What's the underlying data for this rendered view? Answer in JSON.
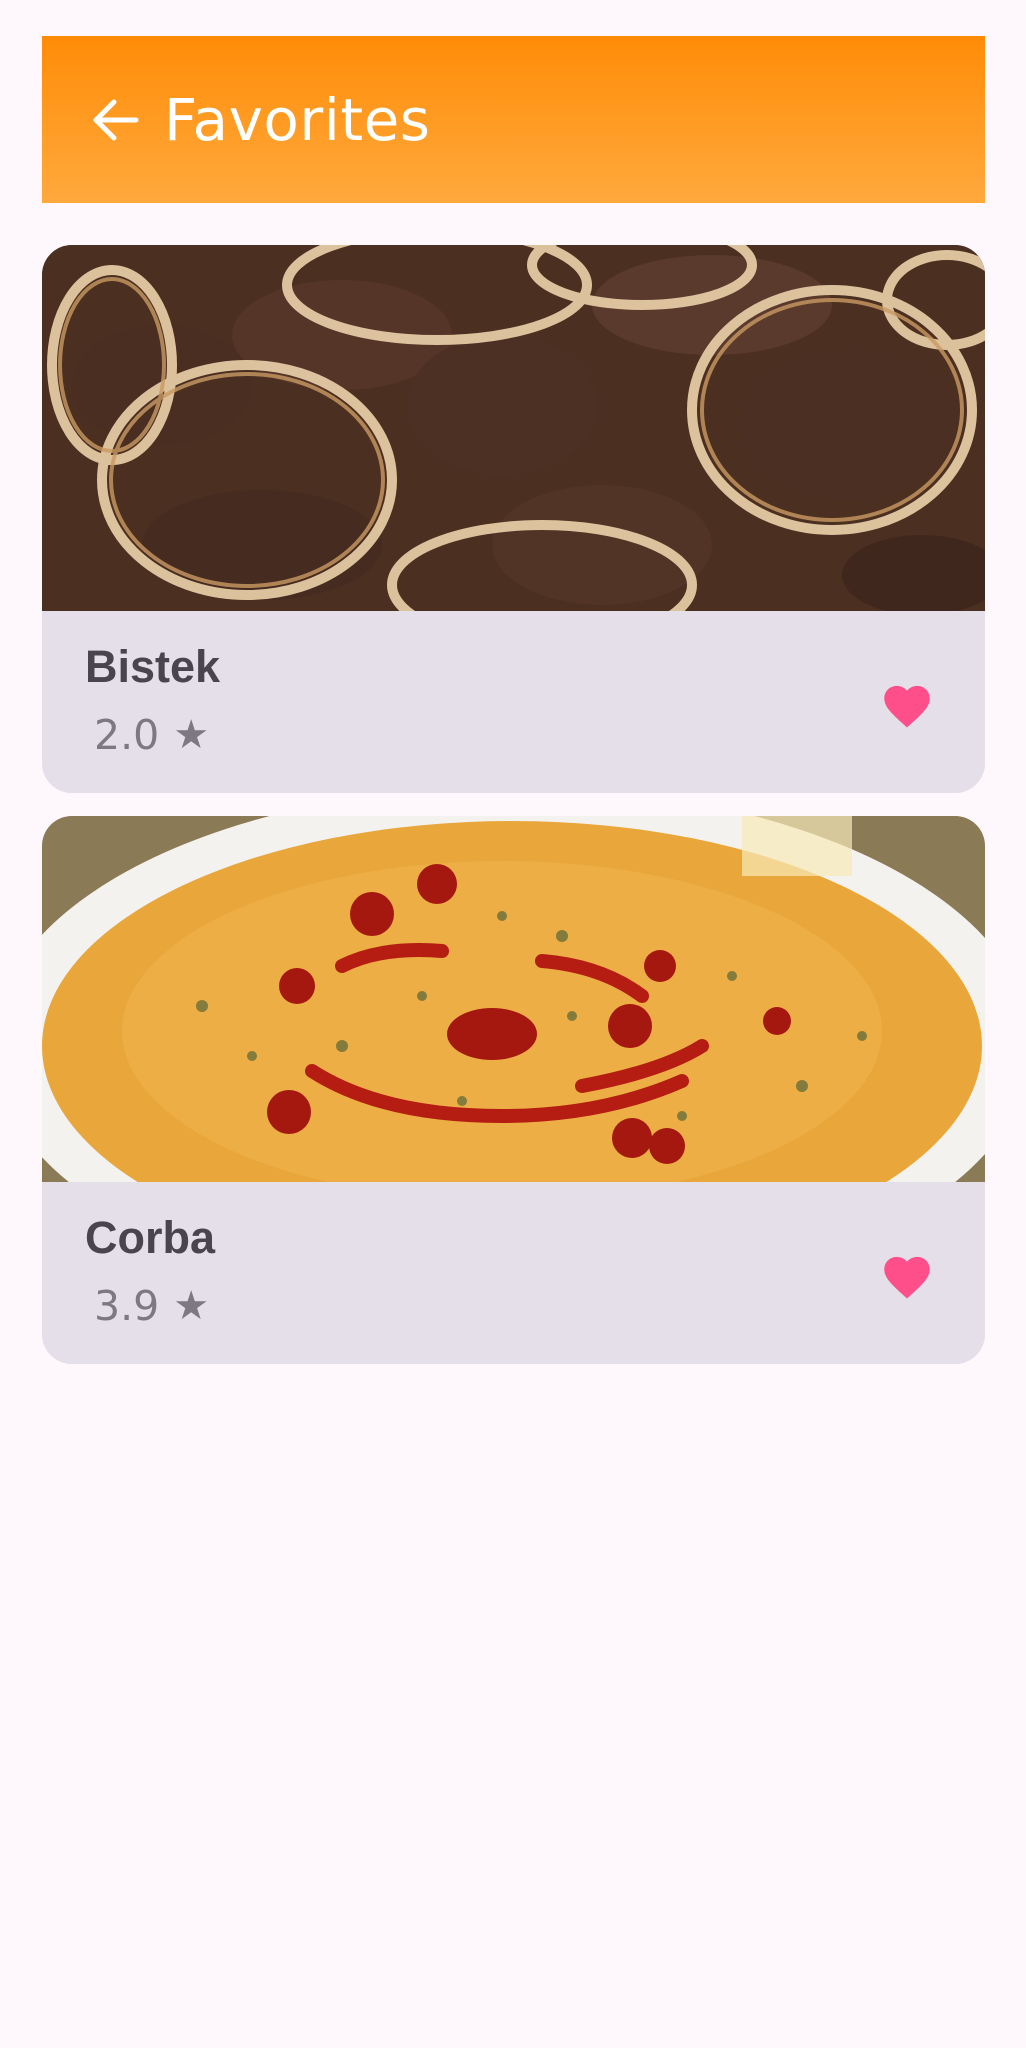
{
  "app_bar": {
    "title": "Favorites",
    "back_icon": "arrow-back-icon",
    "colors": {
      "top": "#ff8c07",
      "bottom": "#ffa93d"
    }
  },
  "favorites": [
    {
      "name": "Bistek",
      "rating": "2.0",
      "rating_icon": "star-icon",
      "favorite_icon": "heart-icon",
      "image": "Beef steak with onion rings in dark sauce"
    },
    {
      "name": "Corba",
      "rating": "3.9",
      "rating_icon": "star-icon",
      "favorite_icon": "heart-icon",
      "image": "Bowl of orange lentil soup drizzled with red pepper oil and herbs"
    }
  ],
  "accent_color": "#ff4f8b"
}
